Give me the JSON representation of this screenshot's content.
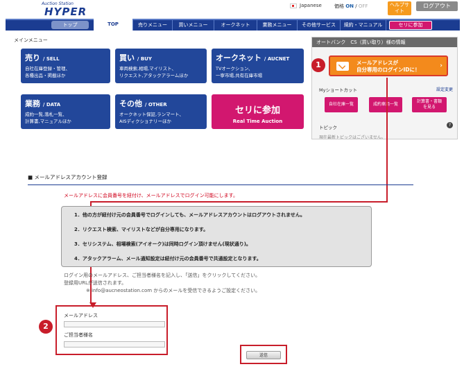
{
  "header": {
    "logo_small": "Auction Station",
    "logo_big": "HYPER",
    "language": "Japanese",
    "price_label": "価格",
    "price_on": "ON",
    "price_separator": "/",
    "price_off": "OFF",
    "help_label": "ヘルプサイト",
    "logout_label": "ログアウト"
  },
  "nav": {
    "items": [
      {
        "label": "TOP"
      },
      {
        "label": "売りメニュー"
      },
      {
        "label": "買いメニュー"
      },
      {
        "label": "オークネット"
      },
      {
        "label": "業務メニュー"
      },
      {
        "label": "その他サービス"
      },
      {
        "label": "規約・マニュアル"
      },
      {
        "label": "セリに参加"
      }
    ],
    "back_label": "トップ"
  },
  "main_menu": {
    "title": "メインメニュー",
    "tiles": [
      {
        "title": "売り",
        "en": "/ SELL",
        "desc1": "自社在庫登録・管理、",
        "desc2": "各種出品・掲載ほか"
      },
      {
        "title": "買い",
        "en": "/ BUY",
        "desc1": "車両検索,相場,マイリスト、",
        "desc2": "リクエスト,アタックアラームほか"
      },
      {
        "title": "オークネット",
        "en": "/ AUCNET",
        "desc1": "TVオークション、",
        "desc2": "一寧市場,共有在庫市場"
      },
      {
        "title": "業務",
        "en": "/ DATA",
        "desc1": "成約一覧,落札一覧、",
        "desc2": "計算書,マニュアルほか"
      },
      {
        "title": "その他",
        "en": "/ OTHER",
        "desc1": "オークネット保証,ランマート、",
        "desc2": "AISディクショナリーほか"
      }
    ],
    "seri": {
      "title": "セリに参加",
      "sub": "Real Time Auction"
    }
  },
  "side_panel": {
    "header": "オートバンク　CS（買い取り）様の情報",
    "mail_banner_line1": "メールアドレスが",
    "mail_banner_line2": "自分専用のログインIDに！",
    "shortcut_label": "Myショートカット",
    "shortcut_setting": "設定変更",
    "shortcuts": [
      {
        "line1": "自社在庫一覧",
        "line2": ""
      },
      {
        "line1": "成約車両一覧",
        "line2": ""
      },
      {
        "line1": "計算書・書類",
        "line2": "を見る"
      }
    ],
    "topic_label": "トピック",
    "topic_help": "?",
    "topic_text": "現在最新トピックはございません。"
  },
  "badges": {
    "one": "1",
    "two": "2"
  },
  "registration": {
    "title": "■ メールアドレスアカウント登録",
    "red_note": "メールアドレスに会員番号を紐付け、メールアドレスでログイン可能にします。",
    "info_lines": [
      "1．他の方が紐付け元の会員番号でログインしても、メールアドレスアカウントはログアウトされません。",
      "2．リクエスト検索、マイリストなどが自分専用になります。",
      "3．セリシステム、相場検索(アイオーク)は同時ログイン頂けません(現状通り)。",
      "4．アタックアラーム、メール通知設定は紐付け元の会員番号で共通設定となります。"
    ],
    "guide_line1": "ログイン用のメールアドレス、ご担当者様名を記入し、「送信」をクリックしてください。",
    "guide_line2": "登録用URLが送信されます。",
    "guide_line3": "※ info@aucneostation.com からのメールを受信できるようご設定ください。",
    "email_label": "メールアドレス",
    "email_value": "",
    "name_label": "ご担当者様名",
    "name_value": "",
    "submit_label": "送信"
  },
  "colors": {
    "navy": "#1b3c91",
    "pink": "#d2176f",
    "orange": "#f38a1c",
    "annotation_red": "#c81d2a"
  }
}
